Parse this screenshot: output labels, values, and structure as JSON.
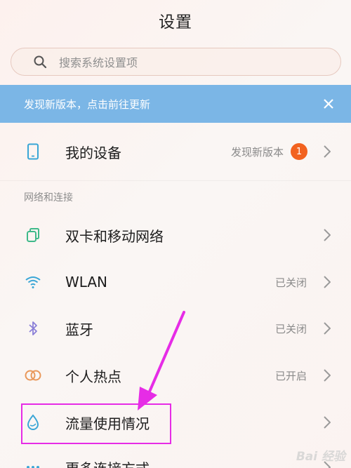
{
  "header": {
    "title": "设置"
  },
  "search": {
    "placeholder": "搜索系统设置项",
    "icon": "search-icon"
  },
  "banner": {
    "text": "发现新版本，点击前往更新",
    "close_icon": "close-icon",
    "color": "#7bb6e6"
  },
  "my_device": {
    "label": "我的设备",
    "status": "发现新版本",
    "badge": "1",
    "icon": "phone-icon",
    "badge_color": "#f2621f"
  },
  "section_network": {
    "title": "网络和连接"
  },
  "network_items": [
    {
      "label": "双卡和移动网络",
      "status": "",
      "icon": "sim-card-icon"
    },
    {
      "label": "WLAN",
      "status": "已关闭",
      "icon": "wifi-icon"
    },
    {
      "label": "蓝牙",
      "status": "已关闭",
      "icon": "bluetooth-icon"
    },
    {
      "label": "个人热点",
      "status": "已开启",
      "icon": "hotspot-icon"
    },
    {
      "label": "流量使用情况",
      "status": "",
      "icon": "data-usage-icon"
    },
    {
      "label": "更多连接方式",
      "status": "",
      "icon": "more-connections-icon"
    }
  ],
  "annotation": {
    "highlight_color": "#e62ce6"
  },
  "watermark": {
    "text": "Bai 经验"
  }
}
